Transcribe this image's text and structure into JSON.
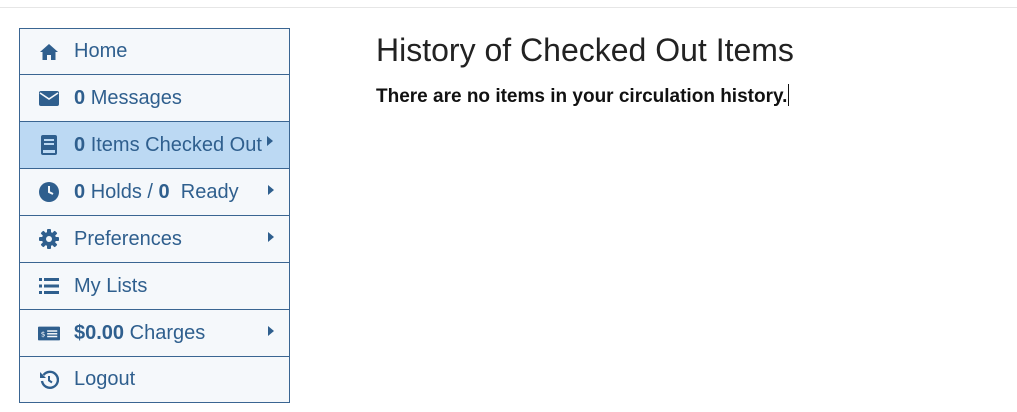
{
  "sidebar": {
    "items": [
      {
        "id": "home",
        "icon": "home-icon",
        "count": "",
        "label": "Home",
        "has_arrow": false,
        "active": false
      },
      {
        "id": "messages",
        "icon": "envelope-icon",
        "count": "0",
        "label": "Messages",
        "has_arrow": false,
        "active": false
      },
      {
        "id": "checked-out",
        "icon": "book-icon",
        "count": "0",
        "label": "Items Checked Out",
        "has_arrow": true,
        "active": true
      },
      {
        "id": "holds",
        "icon": "clock-icon",
        "count": "0",
        "label": "Holds /",
        "count2": "0",
        "label2": "Ready",
        "has_arrow": true,
        "active": false
      },
      {
        "id": "preferences",
        "icon": "gear-icon",
        "count": "",
        "label": "Preferences",
        "has_arrow": true,
        "active": false
      },
      {
        "id": "lists",
        "icon": "list-icon",
        "count": "",
        "label": "My Lists",
        "has_arrow": false,
        "active": false
      },
      {
        "id": "charges",
        "icon": "money-icon",
        "count": "$0.00",
        "label": "Charges",
        "has_arrow": true,
        "active": false
      },
      {
        "id": "logout",
        "icon": "history-icon",
        "count": "",
        "label": "Logout",
        "has_arrow": false,
        "active": false
      }
    ]
  },
  "main": {
    "title": "History of Checked Out Items",
    "message": "There are no items in your circulation history."
  },
  "colors": {
    "link": "#2f5f8e",
    "active_bg": "#bcd9f3",
    "item_bg": "#f5f8fb",
    "border": "#3a6592"
  }
}
